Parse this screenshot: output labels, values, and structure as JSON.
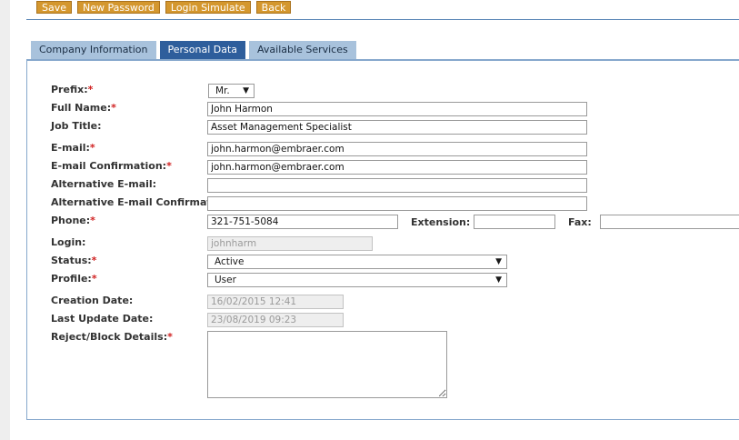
{
  "toolbar": {
    "save": "Save",
    "new_password": "New Password",
    "login_simulate": "Login Simulate",
    "back": "Back"
  },
  "tabs": [
    {
      "label": "Company Information"
    },
    {
      "label": "Personal Data"
    },
    {
      "label": "Available Services"
    }
  ],
  "active_tab": "Personal Data",
  "form": {
    "prefix": {
      "label": "Prefix:",
      "value": "Mr."
    },
    "full_name": {
      "label": "Full Name:",
      "value": "John Harmon"
    },
    "job_title": {
      "label": "Job Title:",
      "value": "Asset Management Specialist"
    },
    "email": {
      "label": "E-mail:",
      "value": "john.harmon@embraer.com"
    },
    "email_confirmation": {
      "label": "E-mail Confirmation:",
      "value": "john.harmon@embraer.com"
    },
    "alt_email": {
      "label": "Alternative E-mail:",
      "value": ""
    },
    "alt_email_confirmation": {
      "label": "Alternative E-mail Confirmation:",
      "value": ""
    },
    "phone": {
      "label": "Phone:",
      "value": "321-751-5084"
    },
    "extension": {
      "label": "Extension:",
      "value": ""
    },
    "fax": {
      "label": "Fax:",
      "value": ""
    },
    "login": {
      "label": "Login:",
      "value": "johnharm"
    },
    "status": {
      "label": "Status:",
      "value": "Active"
    },
    "profile": {
      "label": "Profile:",
      "value": "User"
    },
    "creation_date": {
      "label": "Creation Date:",
      "value": "16/02/2015 12:41"
    },
    "last_update_date": {
      "label": "Last Update Date:",
      "value": "23/08/2019 09:23"
    },
    "reject_block_details": {
      "label": "Reject/Block Details:",
      "value": ""
    }
  },
  "required_marker": "*",
  "dropdown_arrow": "▼",
  "colors": {
    "button_bg": "#d4972e",
    "tab_active": "#2e5e9c",
    "tab_inactive": "#a8c2dc",
    "panel_border": "#86a8cc",
    "required": "#d02020"
  }
}
